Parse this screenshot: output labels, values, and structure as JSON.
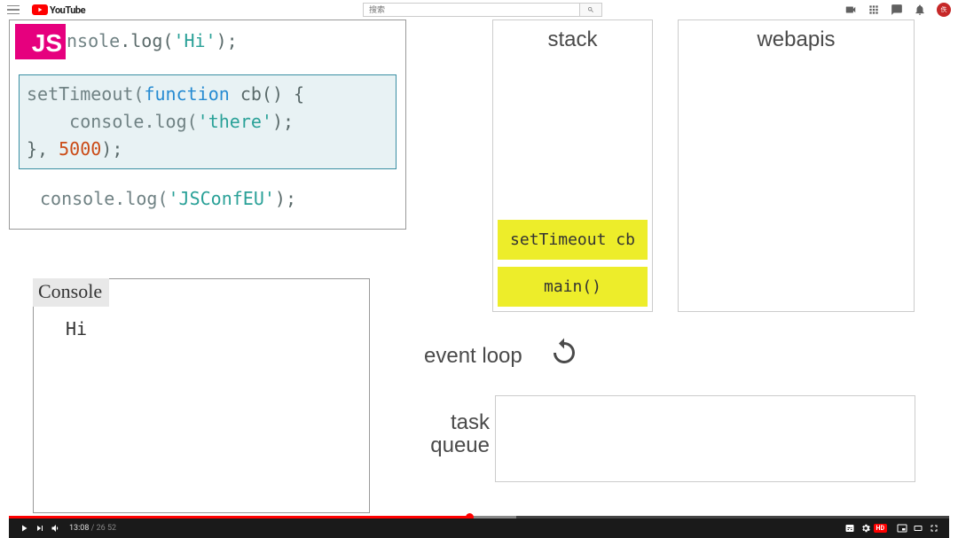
{
  "topbar": {
    "logo_text": "YouTube",
    "search_placeholder": "搜索",
    "avatar_initial": "佚"
  },
  "code": {
    "badge": "JS",
    "line1_a": "nsole",
    "line1_b": ".log(",
    "line1_str": "'Hi'",
    "line1_c": ");",
    "hl_l1_a": "setTimeout(",
    "hl_l1_kw": "function",
    "hl_l1_b": " cb() {",
    "hl_l2_a": "    console.log(",
    "hl_l2_str": "'there'",
    "hl_l2_b": ");",
    "hl_l3_a": "}, ",
    "hl_l3_num": "5000",
    "hl_l3_b": ");",
    "line5_a": "console.log(",
    "line5_str": "'JSConfEU'",
    "line5_b": ");"
  },
  "stack": {
    "title": "stack",
    "frames": [
      "setTimeout cb",
      "main()"
    ]
  },
  "webapis": {
    "title": "webapis"
  },
  "console": {
    "title": "Console",
    "output": "Hi"
  },
  "eventloop": {
    "label": "event loop"
  },
  "taskqueue": {
    "label": "task\nqueue"
  },
  "player": {
    "current": "13:08",
    "sep": " / ",
    "total": "26 52",
    "hd": "HD"
  }
}
